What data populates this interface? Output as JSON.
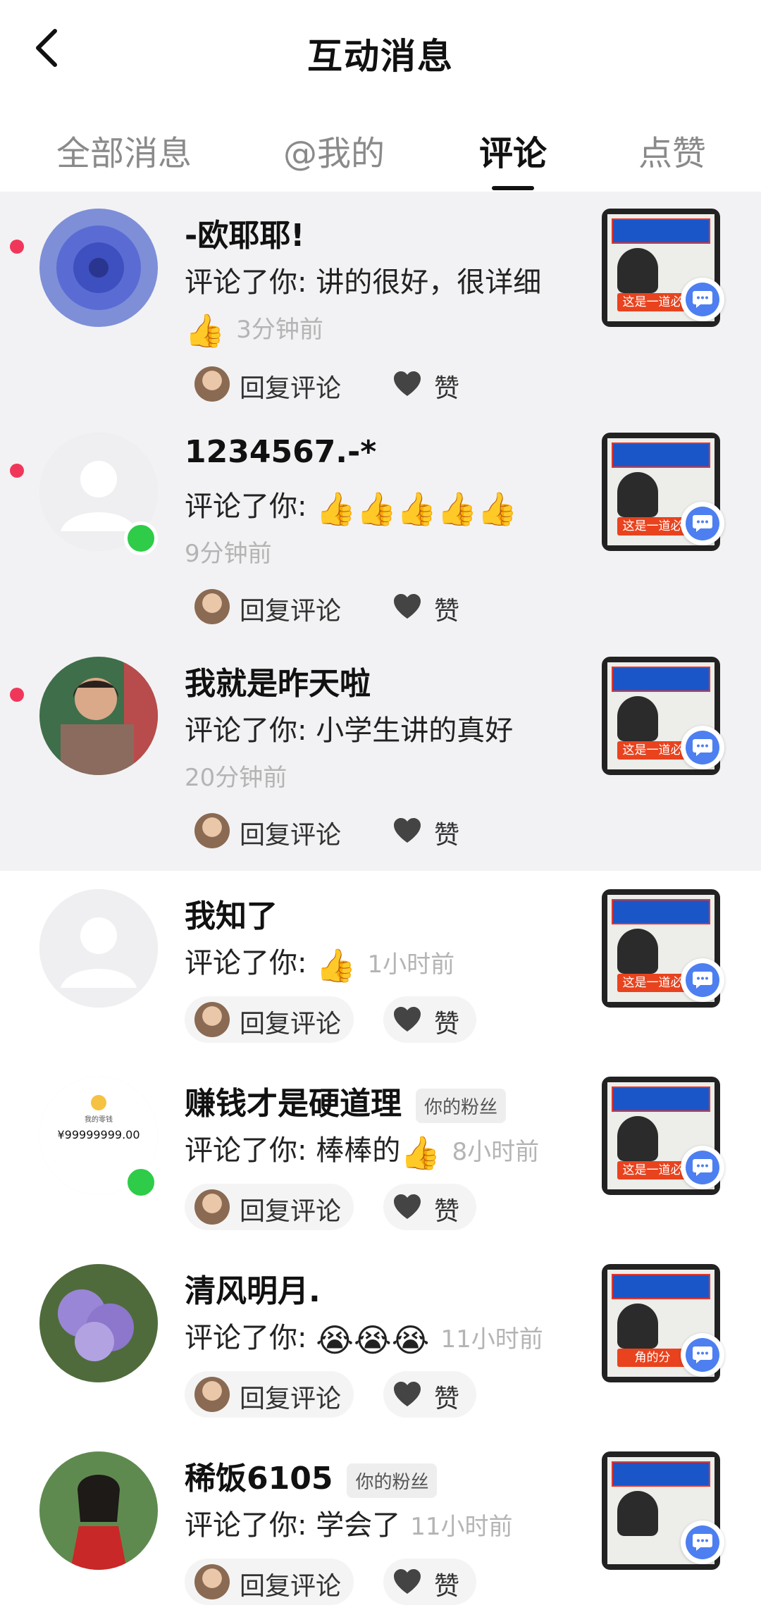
{
  "header": {
    "title": "互动消息"
  },
  "tabs": [
    {
      "label": "全部消息",
      "active": false
    },
    {
      "label": "@我的",
      "active": false
    },
    {
      "label": "评论",
      "active": true
    },
    {
      "label": "点赞",
      "active": false
    }
  ],
  "actions": {
    "reply_label": "回复评论",
    "like_label": "赞"
  },
  "badges": {
    "fan": "你的粉丝"
  },
  "items": [
    {
      "name": "-欧耶耶!",
      "comment": "评论了你: 讲的很好，很详细",
      "emoji": "👍",
      "time": "3分钟前",
      "unread": true,
      "online": false,
      "fan": false,
      "thumb_tag": "这是一道必"
    },
    {
      "name": "1234567.-*",
      "comment": "评论了你: ",
      "emoji": "👍👍👍👍👍",
      "time": "9分钟前",
      "unread": true,
      "online": true,
      "fan": false,
      "thumb_tag": "这是一道必"
    },
    {
      "name": "我就是昨天啦",
      "comment": "评论了你: 小学生讲的真好",
      "emoji": "",
      "time": "20分钟前",
      "unread": true,
      "online": false,
      "fan": false,
      "thumb_tag": "这是一道必"
    },
    {
      "name": "我知了",
      "comment": "评论了你: ",
      "emoji": "👍",
      "time": "1小时前",
      "unread": false,
      "online": false,
      "fan": false,
      "thumb_tag": "这是一道必"
    },
    {
      "name": "赚钱才是硬道理",
      "comment": "评论了你: 棒棒的",
      "emoji": "👍",
      "time": "8小时前",
      "unread": false,
      "online": true,
      "fan": true,
      "avatar_text": "¥99999999.00",
      "avatar_small": "我的零钱",
      "thumb_tag": "这是一道必"
    },
    {
      "name": "清风明月.",
      "comment": "评论了你: ",
      "emoji": "😭😭😭",
      "time": "11小时前",
      "unread": false,
      "online": false,
      "fan": false,
      "thumb_tag": "角的分"
    },
    {
      "name": "稀饭6105",
      "comment": "评论了你: 学会了",
      "emoji": "",
      "time": "11小时前",
      "unread": false,
      "online": false,
      "fan": true,
      "thumb_tag": ""
    }
  ],
  "colors": {
    "unread_dot": "#f0375a",
    "online": "#2ecc48",
    "bubble": "#4d7ff0",
    "unread_bg": "#f2f2f4"
  },
  "icons": {
    "back": "chevron-left-icon",
    "heart": "heart-icon",
    "chat": "chat-bubble-icon",
    "thumb": "thumbs-up-emoji"
  }
}
